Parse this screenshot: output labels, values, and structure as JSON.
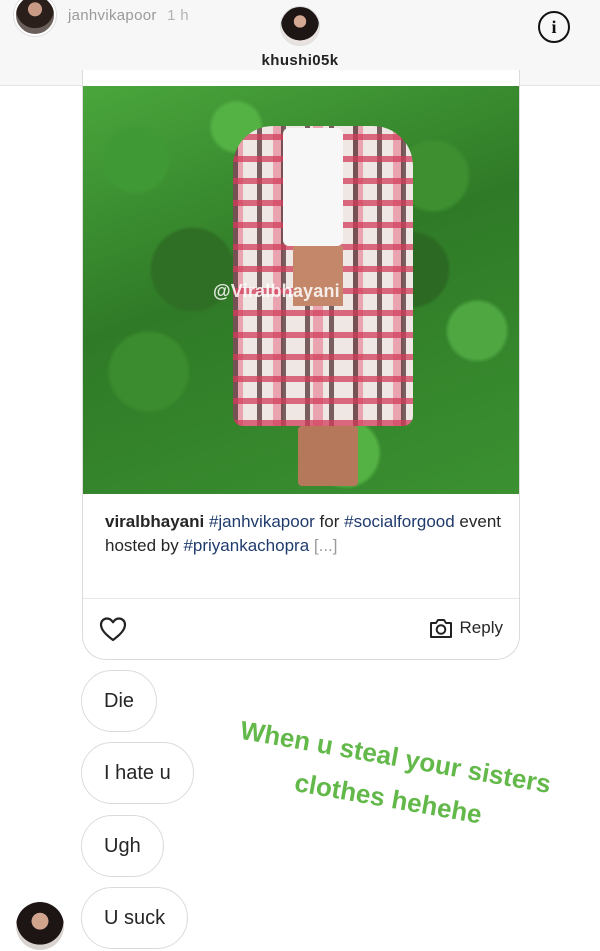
{
  "header": {
    "story_owner": "janhvikapoor",
    "story_time": "1 h",
    "chat_username": "khushi05k",
    "info_icon": "info-icon"
  },
  "shared_post": {
    "watermark": "@Viralbhayani",
    "caption_user": "viralbhayani",
    "caption_tag1": "#janhvikapoor",
    "caption_text1": " for ",
    "caption_tag2": "#socialforgood",
    "caption_text2": " event hosted  by ",
    "caption_tag3": "#priyankachopra",
    "caption_more": "[...]",
    "reply_label": "Reply",
    "like_icon": "heart-icon",
    "reply_icon": "camera-icon"
  },
  "messages": [
    {
      "text": "Die"
    },
    {
      "text": "I hate u"
    },
    {
      "text": "Ugh"
    },
    {
      "text": "U suck"
    }
  ],
  "overlay": {
    "line1": "When u steal your sisters",
    "line2": "clothes hehehe",
    "color": "#63b84a"
  }
}
